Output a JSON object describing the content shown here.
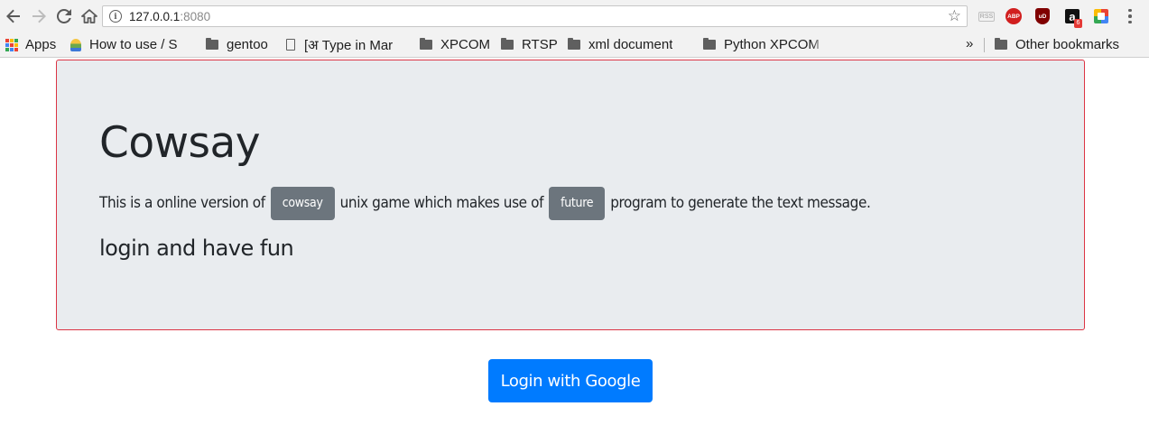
{
  "browser": {
    "url_host": "127.0.0.1",
    "url_port": ":8080",
    "extensions": {
      "abp_label": "ABP",
      "ublock_label": "uD",
      "amazon_label": "a",
      "amazon_badge": "6",
      "rss_label": "RSS"
    },
    "icons": [
      "back-icon",
      "forward-icon",
      "reload-icon",
      "home-icon",
      "info-icon",
      "star-icon",
      "menu-icon"
    ]
  },
  "bookmarks": {
    "apps": "Apps",
    "items": [
      {
        "label": "How to use / S",
        "icon": "favicon"
      },
      {
        "label": "gentoo",
        "icon": "folder-icon"
      },
      {
        "label": "[अ Type in Mar",
        "icon": "page-icon"
      },
      {
        "label": "XPCOM",
        "icon": "folder-icon"
      },
      {
        "label": "RTSP",
        "icon": "folder-icon"
      },
      {
        "label": "xml document",
        "icon": "folder-icon"
      },
      {
        "label": "Python XPCOM",
        "icon": "folder-icon"
      }
    ],
    "overflow": "»",
    "other": "Other bookmarks"
  },
  "page": {
    "title": "Cowsay",
    "lead_before": "This is a online version of",
    "badge_cowsay": "cowsay",
    "lead_middle": "unix game which makes use of",
    "badge_future": "future",
    "lead_after": "program to generate the text message.",
    "subheading": "login and have fun",
    "login_button": "Login with Google"
  },
  "colors": {
    "jumbotron_bg": "#e9ecef",
    "jumbotron_border": "#dc3545",
    "badge_bg": "#6c757d",
    "button_bg": "#007bff"
  }
}
